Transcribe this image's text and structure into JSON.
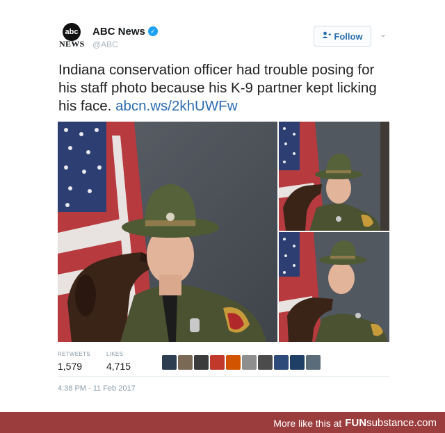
{
  "tweet": {
    "avatar": {
      "logo_text": "abc",
      "wordmark": "NEWS"
    },
    "display_name": "ABC News",
    "verified_icon": "verified-badge-icon",
    "handle": "@ABC",
    "follow_label": "Follow",
    "text": "Indiana conservation officer had trouble posing for his staff photo because his K-9 partner kept licking his face.",
    "link": "abcn.ws/2khUWFw",
    "stats": {
      "retweets_label": "RETWEETS",
      "retweets_value": "1,579",
      "likes_label": "LIKES",
      "likes_value": "4,715"
    },
    "timestamp": "4:38 PM - 11 Feb 2017",
    "liker_colors": [
      "#2c3e50",
      "#7a6a55",
      "#3b3b3b",
      "#c0392b",
      "#d35400",
      "#8e8e8e",
      "#4b4b4b",
      "#2e4a7a",
      "#1f3f66",
      "#5a6b7a"
    ]
  },
  "footer": {
    "prefix": "More like this at",
    "brand_fun": "FUN",
    "brand_sub": "substance",
    "brand_suffix": ".com"
  },
  "colors": {
    "footer_bg": "#9c3d3d",
    "link": "#2b6cb0",
    "follow_text": "#2a6fb0",
    "verified": "#1da1f2"
  }
}
